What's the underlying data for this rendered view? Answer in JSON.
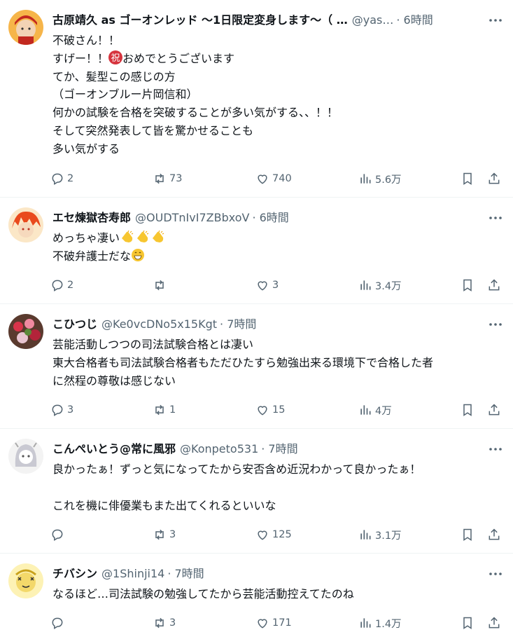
{
  "tweets": [
    {
      "name": "古原靖久 as ゴーオンレッド ～1日限定変身します～（ …",
      "handle": "@yas…",
      "time": "· 6時間",
      "lines": [
        "不破さん！！",
        "すげー！！",
        "てか、髪型この感じの方",
        "（ゴーオンブルー片岡信和）",
        "何かの試験を合格を突破することが多い気がする、、！！",
        "そして突然発表して皆を驚かせることも",
        "多い気がする"
      ],
      "line2_suffix": "おめでとうございます",
      "replies": "2",
      "reposts": "73",
      "likes": "740",
      "views": "5.6万"
    },
    {
      "name": "エセ煉獄杏寿郎",
      "handle": "@OUDTnIvI7ZBbxoV",
      "time": "· 6時間",
      "lines": [
        "めっちゃ凄い",
        "不破弁護士だな"
      ],
      "replies": "2",
      "reposts": "",
      "likes": "3",
      "views": "3.4万"
    },
    {
      "name": "こひつじ",
      "handle": "@Ke0vcDNo5x15Kgt",
      "time": "· 7時間",
      "lines": [
        "芸能活動しつつの司法試験合格とは凄い",
        "東大合格者も司法試験合格者もただひたすら勉強出来る環境下で合格した者",
        "に然程の尊敬は感じない"
      ],
      "replies": "3",
      "reposts": "1",
      "likes": "15",
      "views": "4万"
    },
    {
      "name": "こんぺいとう@常に風邪",
      "handle": "@Konpeto531",
      "time": "· 7時間",
      "lines": [
        "良かったぁ！ずっと気になってたから安否含め近況わかって良かったぁ！",
        "",
        "これを機に俳優業もまた出てくれるといいな"
      ],
      "replies": "",
      "reposts": "3",
      "likes": "125",
      "views": "3.1万"
    },
    {
      "name": "チバシン",
      "handle": "@1Shinji14",
      "time": "· 7時間",
      "lines": [
        "なるほど…司法試験の勉強してたから芸能活動控えてたのね"
      ],
      "replies": "",
      "reposts": "3",
      "likes": "171",
      "views": "1.4万"
    }
  ],
  "colors": {
    "text": "#0f1419",
    "secondary": "#536471",
    "divider": "#eff3f4",
    "celebrate_badge": "#d6343e"
  },
  "icons": [
    "reply-icon",
    "repost-icon",
    "like-icon",
    "views-icon",
    "bookmark-icon",
    "share-icon",
    "more-icon",
    "clap-emoji",
    "grin-emoji",
    "celebrate-emoji"
  ]
}
